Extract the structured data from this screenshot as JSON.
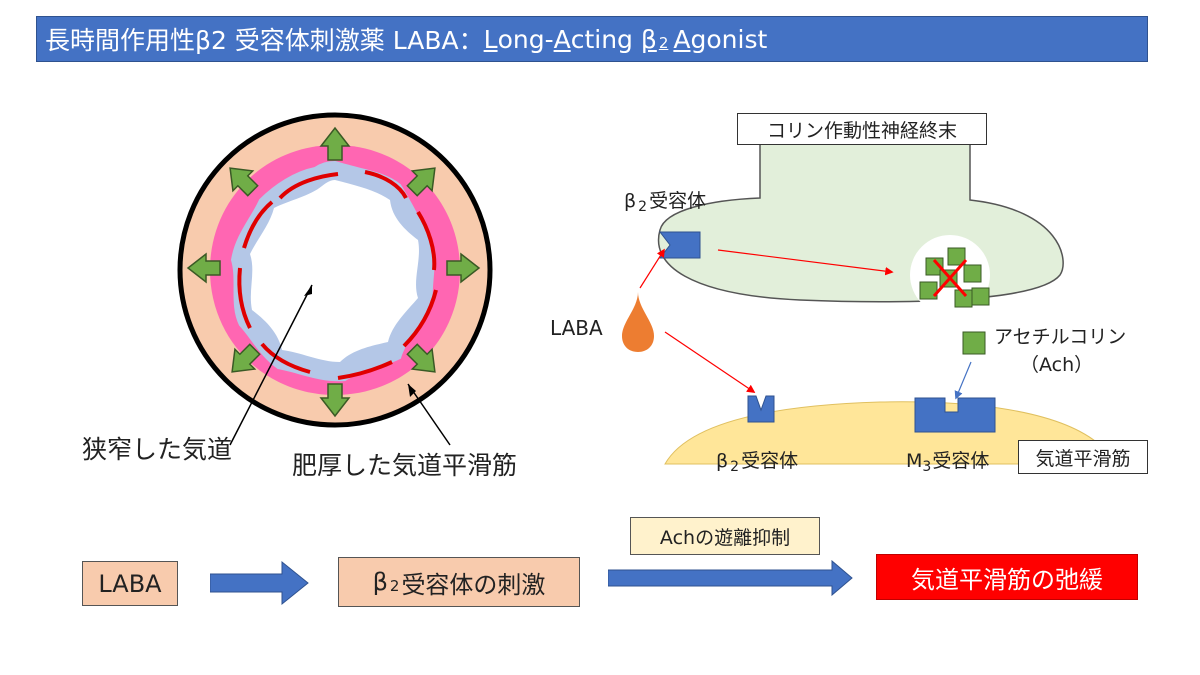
{
  "title": {
    "main": "長時間作用性β2 受容体刺激薬 LABA：",
    "en_l1": "L",
    "en_r1": "ong-",
    "en_l2": "A",
    "en_r2": "cting ",
    "beta": "β",
    "beta_sub": "2",
    "en_l3": "A",
    "en_r3": "gonist"
  },
  "airway": {
    "narrow_label": "狭窄した気道",
    "thick_label": "肥厚した気道平滑筋"
  },
  "mechanism": {
    "nerve_label": "コリン作動性神経終末",
    "beta2_nerve_label": "β",
    "beta2_nerve_sub": "2",
    "beta2_nerve_suffix": "受容体",
    "laba_label": "LABA",
    "ach_label_line1": "アセチルコリン",
    "ach_label_line2": "（Ach）",
    "smooth_beta_prefix": "β",
    "smooth_beta_sub": "2",
    "smooth_beta_suffix": "受容体",
    "m3_prefix": "M",
    "m3_sub": "3",
    "m3_suffix": "受容体",
    "smooth_muscle_label": "気道平滑筋"
  },
  "flow": {
    "laba": "LABA",
    "beta_prefix": "β",
    "beta_sub": "2",
    "beta_suffix": "受容体の刺激",
    "ach_inhibit": "Achの遊離抑制",
    "result": "気道平滑筋の弛緩"
  },
  "colors": {
    "title_bg": "#4472c4",
    "wall_outer": "#f8cbad",
    "smooth_muscle": "#ff66b2",
    "mucosa": "#b4c7e7",
    "arrow_green": "#70ad47",
    "nerve_fill": "#e2efda",
    "muscle_fill": "#ffe699",
    "receptor_blue": "#4472c4",
    "laba_drop": "#ed7d31",
    "ach_square": "#70ad47",
    "red": "#ff0000"
  }
}
